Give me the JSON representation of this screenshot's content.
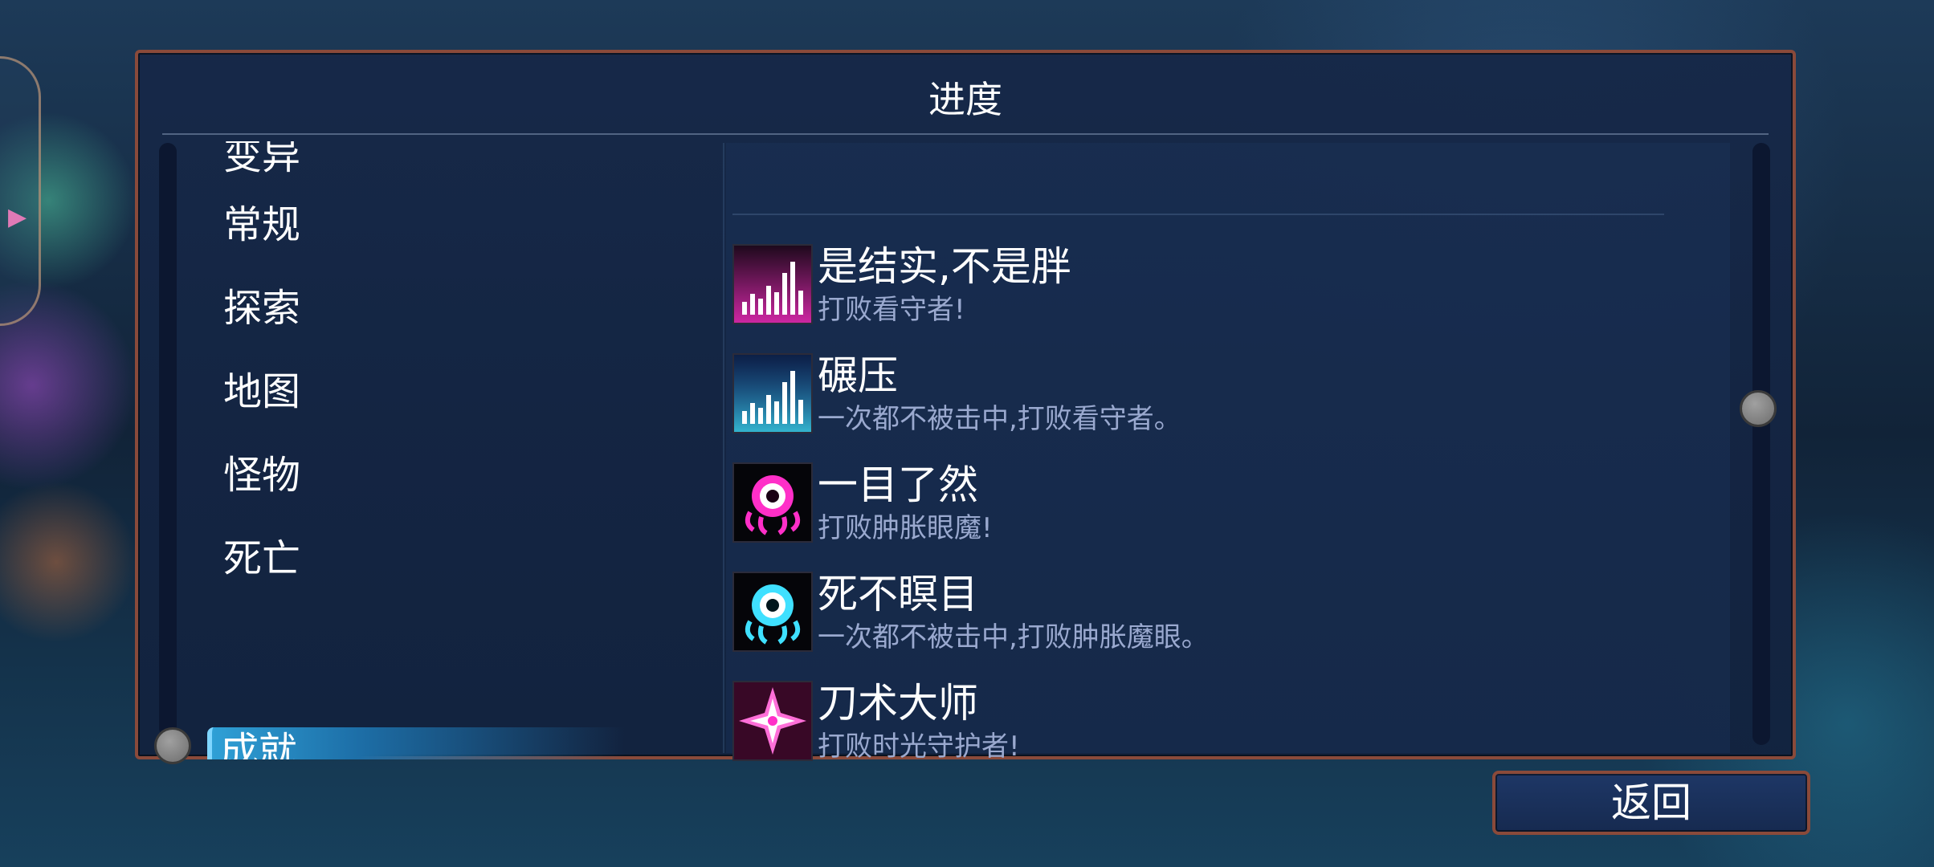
{
  "panel": {
    "title": "进度"
  },
  "categories": [
    {
      "label": "变异",
      "active": false
    },
    {
      "label": "常规",
      "active": false
    },
    {
      "label": "探索",
      "active": false
    },
    {
      "label": "地图",
      "active": false
    },
    {
      "label": "怪物",
      "active": false
    },
    {
      "label": "死亡",
      "active": false
    },
    {
      "label": "成就",
      "active": true
    }
  ],
  "achievements": [
    {
      "title": "是结实,不是胖",
      "description": "打败看守者!",
      "icon": "magenta-bars-icon",
      "color": "#ff2fc8"
    },
    {
      "title": "碾压",
      "description": "一次都不被击中,打败看守者。",
      "icon": "cyan-bars-icon",
      "color": "#3fe0ff"
    },
    {
      "title": "一目了然",
      "description": "打败肿胀眼魔!",
      "icon": "magenta-eye-monster-icon",
      "color": "#ff2fc8"
    },
    {
      "title": "死不瞑目",
      "description": "一次都不被击中,打败肿胀魔眼。",
      "icon": "cyan-eye-monster-icon",
      "color": "#3fe0ff"
    },
    {
      "title": "刀术大师",
      "description": "打败时光守护者!",
      "icon": "shuriken-icon",
      "color": "#ff2fc8"
    }
  ],
  "back_button": {
    "label": "返回"
  }
}
